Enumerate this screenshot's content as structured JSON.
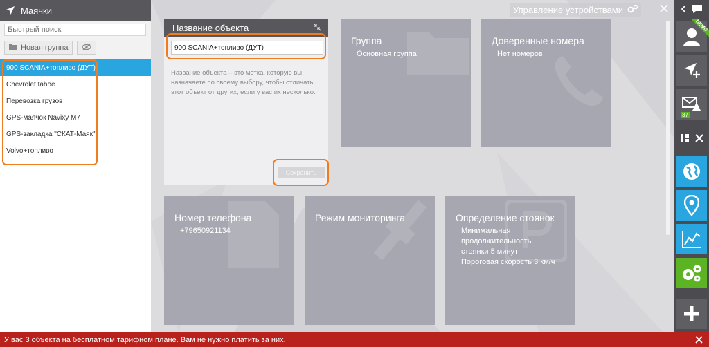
{
  "sidebar": {
    "title": "Маячки",
    "search_placeholder": "Быстрый поиск",
    "new_group_label": "Новая группа",
    "trackers": [
      "900 SCANIA+топливо (ДУТ)",
      "Chevrolet tahoe",
      "Перевозка грузов",
      "GPS-маячок Navixy M7",
      "GPS-закладка \"СКАТ-Маяк\"",
      "Volvo+топливо"
    ],
    "selected_index": 0
  },
  "main": {
    "title": "Управление устройствами",
    "name_panel": {
      "title": "Название объекта",
      "input_value": "900 SCANIA+топливо (ДУТ)",
      "description": "Название объекта – это метка, которую вы назначаете по своему выбору, чтобы отличать этот объект от других, если у вас их несколько.",
      "save_label": "Сохранить"
    },
    "tiles": {
      "group": {
        "title": "Группа",
        "value": "Основная группа"
      },
      "trusted": {
        "title": "Доверенные номера",
        "value": "Нет номеров"
      },
      "phone": {
        "title": "Номер телефона",
        "value": "+79650921134"
      },
      "monitoring": {
        "title": "Режим мониторинга"
      },
      "parking": {
        "title": "Определение стоянок",
        "line1": "Минимальная",
        "line2": "продолжительность",
        "line3": "стоянки 5 минут",
        "line4": "Пороговая скорость 3 км/ч"
      }
    }
  },
  "rightbar": {
    "demo_label": "DEMO",
    "messages_count": "37"
  },
  "banner": {
    "text": "У вас 3 объекта на бесплатном тарифном плане. Вам не нужно платить за них."
  },
  "colors": {
    "accent_blue": "#29a6e0",
    "accent_green": "#5cb324",
    "highlight_orange": "#f07c1e",
    "banner_red": "#b8211c",
    "tile_gray": "#a7a7b2"
  }
}
